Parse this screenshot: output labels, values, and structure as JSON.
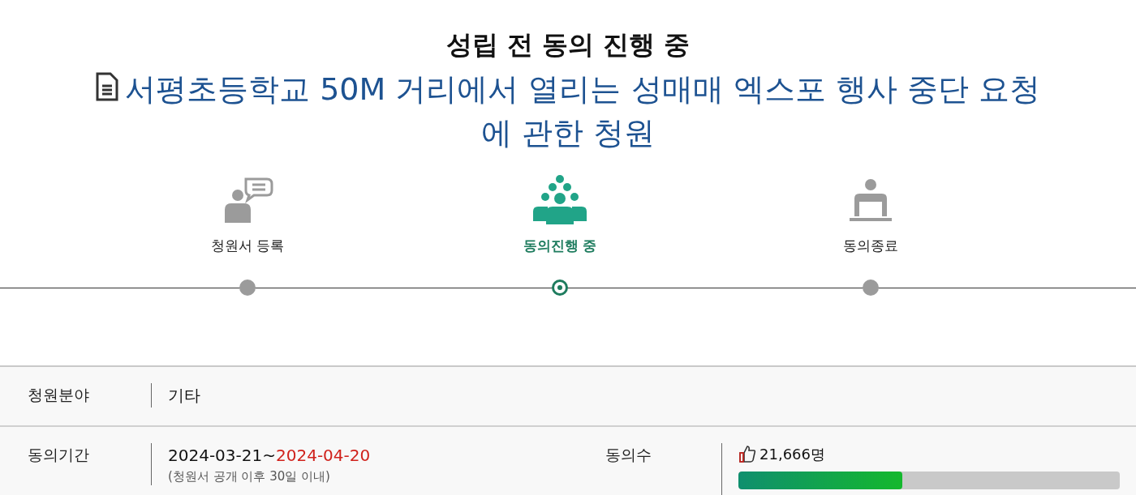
{
  "status_heading": "성립 전 동의 진행 중",
  "petition_title": "서평초등학교 50M 거리에서 열리는 성매매 엑스포 행사 중단 요청에 관한 청원",
  "steps": [
    {
      "kind": "register",
      "label": "청원서 등록",
      "selected": false
    },
    {
      "kind": "progress",
      "label": "동의진행 중",
      "selected": true
    },
    {
      "kind": "closed",
      "label": "동의종료",
      "selected": false
    }
  ],
  "info": {
    "category_label": "청원분야",
    "category_value": "기타",
    "period_label": "동의기간",
    "period_start": "2024-03-21~",
    "period_end": "2024-04-20",
    "period_note": "(청원서 공개 이후 30일 이내)",
    "count_label": "동의수",
    "count_value": "21,666명",
    "level": 0.43
  }
}
